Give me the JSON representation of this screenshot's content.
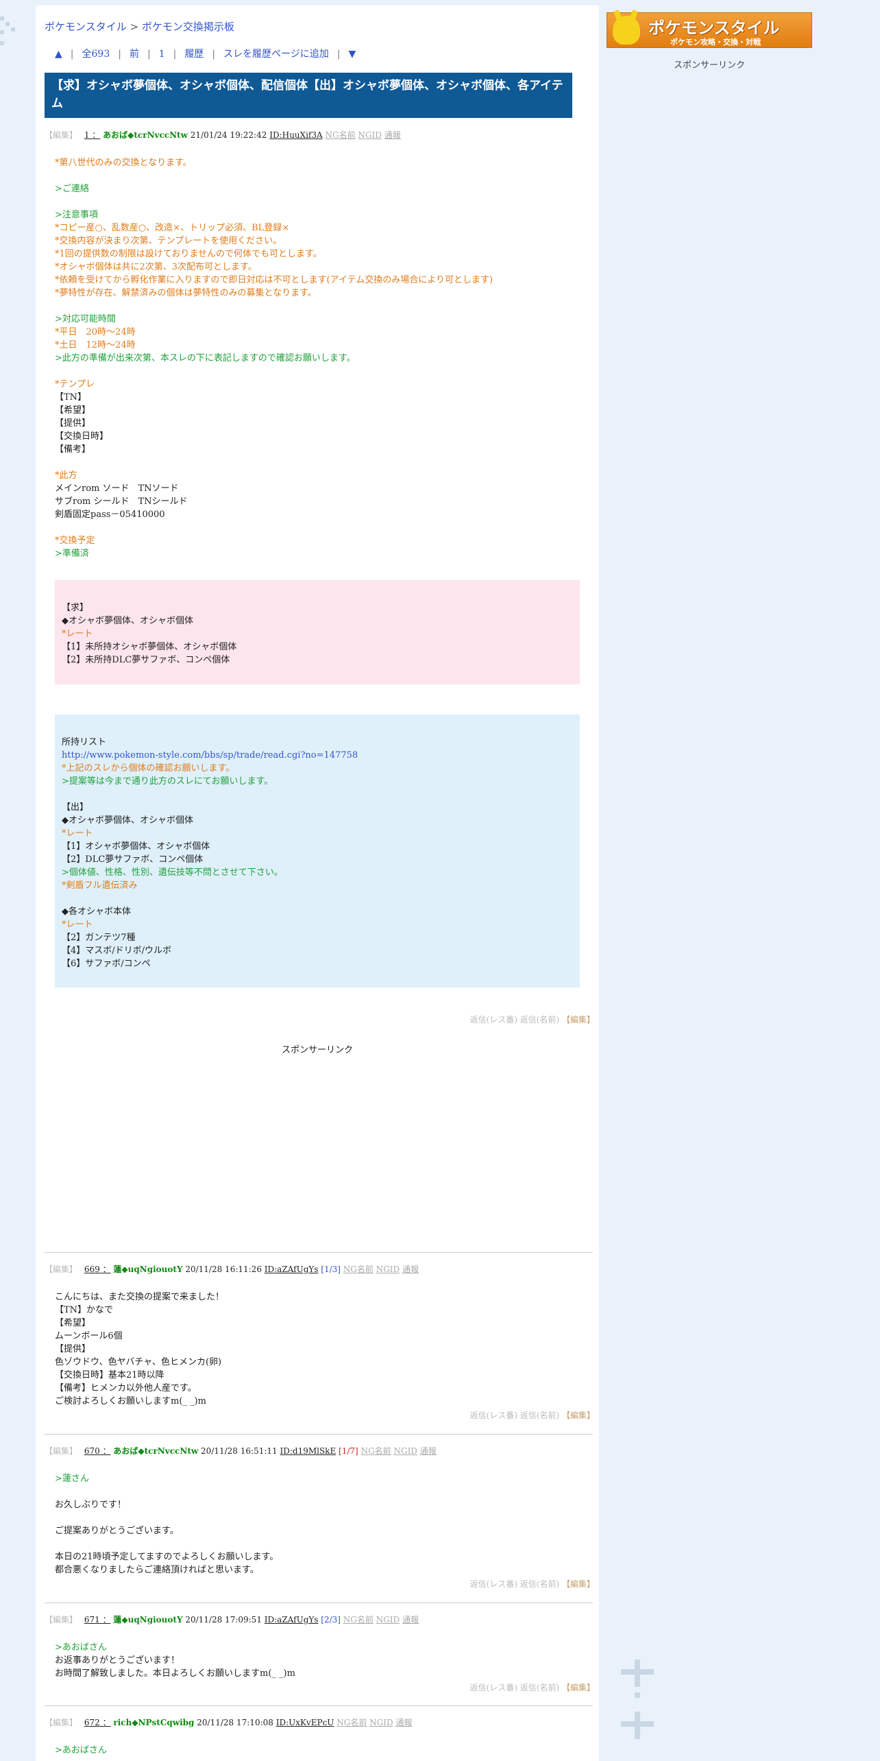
{
  "breadcrumb": {
    "home": "ポケモンスタイル",
    "sep": " > ",
    "board": "ポケモン交換掲示板"
  },
  "nav": [
    {
      "name": "nav-top",
      "label": "▲"
    },
    {
      "name": "nav-all",
      "label": "全693"
    },
    {
      "name": "nav-prev",
      "label": "前"
    },
    {
      "name": "nav-first",
      "label": "1"
    },
    {
      "name": "nav-history",
      "label": "履歴"
    },
    {
      "name": "nav-add-history",
      "label": "スレを履歴ページに追加"
    },
    {
      "name": "nav-bottom",
      "label": "▼"
    }
  ],
  "nav_sep": "|",
  "thread_title": "【求】オシャボ夢個体、オシャボ個体、配信個体【出】オシャボ夢個体、オシャボ個体、各アイテム",
  "labels": {
    "edit": "【編集】",
    "ng_name": "NG名前",
    "ngid": "NGID",
    "report": "通報",
    "reply_res": "返信(レス番)",
    "reply_name": "返信(名前)",
    "edit_foot": "【編集】"
  },
  "sponsor": "スポンサーリンク",
  "side": {
    "banner_title": "ポケモンスタイル",
    "banner_sub": "ポケモン攻略・交換・対戦",
    "sponsor": "スポンサーリンク"
  },
  "colors": {
    "title_bg": "#0f5995",
    "orange": "#e07b1a",
    "green": "#22a03a",
    "name": "#118811",
    "pink_box": "#fde5ee",
    "blue_box": "#dff0fa"
  },
  "op": {
    "num": "1 ：",
    "name": "あおば◆tcrNvccNtw",
    "date": "21/01/24 19:22:42",
    "id": "ID:HuuXif3A",
    "lines": [
      {
        "c": "or",
        "t": "*第八世代のみの交換となります。"
      },
      {
        "c": "bk",
        "t": ""
      },
      {
        "c": "gr",
        "t": ">ご連絡"
      },
      {
        "c": "bk",
        "t": ""
      },
      {
        "c": "gr",
        "t": ">注意事項"
      },
      {
        "c": "or",
        "t": "*コピー産○、乱数産○、改造×、トリップ必須、BL登録×"
      },
      {
        "c": "or",
        "t": "*交換内容が決まり次第、テンプレートを使用ください。"
      },
      {
        "c": "or",
        "t": "*1回の提供数の制限は設けておりませんので何体でも可とします。"
      },
      {
        "c": "or",
        "t": "*オシャボ個体は共に2次第、3次配布可とします。"
      },
      {
        "c": "or",
        "t": "*依頼を受けてから孵化作業に入りますので即日対応は不可とします(アイテム交換のみ場合により可とします)"
      },
      {
        "c": "or",
        "t": "*夢特性が存在、解禁済みの個体は夢特性のみの募集となります。"
      },
      {
        "c": "bk",
        "t": ""
      },
      {
        "c": "gr",
        "t": ">対応可能時間"
      },
      {
        "c": "or",
        "t": "*平日　20時～24時"
      },
      {
        "c": "or",
        "t": "*土日　12時～24時"
      },
      {
        "c": "gr",
        "t": ">此方の準備が出来次第、本スレの下に表記しますので確認お願いします。"
      },
      {
        "c": "bk",
        "t": ""
      },
      {
        "c": "or",
        "t": "*テンプレ"
      },
      {
        "c": "bk",
        "t": "【TN】"
      },
      {
        "c": "bk",
        "t": "【希望】"
      },
      {
        "c": "bk",
        "t": "【提供】"
      },
      {
        "c": "bk",
        "t": "【交換日時】"
      },
      {
        "c": "bk",
        "t": "【備考】"
      },
      {
        "c": "bk",
        "t": ""
      },
      {
        "c": "or",
        "t": "*此方"
      },
      {
        "c": "bk",
        "t": "メインrom ソード　TNソード"
      },
      {
        "c": "bk",
        "t": "サブrom シールド　TNシールド"
      },
      {
        "c": "bk",
        "t": "剣盾固定pass－05410000"
      },
      {
        "c": "bk",
        "t": ""
      },
      {
        "c": "or",
        "t": "*交換予定"
      },
      {
        "c": "gr",
        "t": ">準備済"
      }
    ],
    "pink_lines": [
      {
        "c": "bk",
        "t": ""
      },
      {
        "c": "bk",
        "t": "【求】"
      },
      {
        "c": "bk",
        "t": "◆オシャボ夢個体、オシャボ個体"
      },
      {
        "c": "or",
        "t": "*レート"
      },
      {
        "c": "bk",
        "t": "【1】未所持オシャボ夢個体、オシャボ個体"
      },
      {
        "c": "bk",
        "t": "【2】未所持DLC夢サファボ、コンペ個体"
      }
    ],
    "blue_lines": [
      {
        "c": "bk",
        "t": ""
      },
      {
        "c": "bk",
        "t": "所持リスト"
      },
      {
        "c": "ln",
        "t": "http://www.pokemon-style.com/bbs/sp/trade/read.cgi?no=147758"
      },
      {
        "c": "or",
        "t": "*上記のスレから個体の確認お願いします。"
      },
      {
        "c": "gr",
        "t": ">提案等は今まで通り此方のスレにてお願いします。"
      },
      {
        "c": "bk",
        "t": ""
      },
      {
        "c": "bk",
        "t": "【出】"
      },
      {
        "c": "bk",
        "t": "◆オシャボ夢個体、オシャボ個体"
      },
      {
        "c": "or",
        "t": "*レート"
      },
      {
        "c": "bk",
        "t": "【1】オシャボ夢個体、オシャボ個体"
      },
      {
        "c": "bk",
        "t": "【2】DLC夢サファボ、コンペ個体"
      },
      {
        "c": "gr",
        "t": ">個体値、性格、性別、遺伝技等不問とさせて下さい。"
      },
      {
        "c": "or",
        "t": "*剣盾フル遺伝済み"
      },
      {
        "c": "bk",
        "t": ""
      },
      {
        "c": "bk",
        "t": "◆各オシャボ本体"
      },
      {
        "c": "or",
        "t": "*レート"
      },
      {
        "c": "bk",
        "t": "【2】ガンテツ7種"
      },
      {
        "c": "bk",
        "t": "【4】マスボ/ドリボ/ウルボ"
      },
      {
        "c": "bk",
        "t": "【6】サファボ/コンペ"
      }
    ]
  },
  "replies": [
    {
      "num": "669 ：",
      "name": "蓮◆uqNgiouotY",
      "date": "20/11/28 16:11:26",
      "id": "ID:aZAfUgYs",
      "count": "[1/3]",
      "lines": [
        {
          "c": "bk",
          "t": "こんにちは、また交換の提案で来ました！"
        },
        {
          "c": "bk",
          "t": "【TN】かなで"
        },
        {
          "c": "bk",
          "t": "【希望】"
        },
        {
          "c": "bk",
          "t": "ムーンボール6個"
        },
        {
          "c": "bk",
          "t": "【提供】"
        },
        {
          "c": "bk",
          "t": "色ゾウドウ、色ヤバチャ、色ヒメンカ(卵)"
        },
        {
          "c": "bk",
          "t": "【交換日時】基本21時以降"
        },
        {
          "c": "bk",
          "t": "【備考】ヒメンカ以外他人産です。"
        },
        {
          "c": "bk",
          "t": "ご検討よろしくお願いしますm(_ _)m"
        }
      ]
    },
    {
      "num": "670 ：",
      "name": "あおば◆tcrNvccNtw",
      "date": "20/11/28 16:51:11",
      "id": "ID:d19MlSkE",
      "count": "[1/7]",
      "lines": [
        {
          "c": "gr",
          "t": ">蓮さん"
        },
        {
          "c": "bk",
          "t": ""
        },
        {
          "c": "bk",
          "t": "お久しぶりです！"
        },
        {
          "c": "bk",
          "t": ""
        },
        {
          "c": "bk",
          "t": "ご提案ありがとうございます。"
        },
        {
          "c": "bk",
          "t": ""
        },
        {
          "c": "bk",
          "t": "本日の21時頃予定してますのでよろしくお願いします。"
        },
        {
          "c": "bk",
          "t": "都合悪くなりましたらご連絡頂ければと思います。"
        }
      ]
    },
    {
      "num": "671 ：",
      "name": "蓮◆uqNgiouotY",
      "date": "20/11/28 17:09:51",
      "id": "ID:aZAfUgYs",
      "count": "[2/3]",
      "lines": [
        {
          "c": "gr",
          "t": ">あおばさん"
        },
        {
          "c": "bk",
          "t": "お返事ありがとうございます！"
        },
        {
          "c": "bk",
          "t": "お時間了解致しました。本日よろしくお願いしますm(_ _)m"
        }
      ]
    },
    {
      "num": "672 ：",
      "name": "rich◆NPstCqwibg",
      "date": "20/11/28 17:10:08",
      "id": "ID:UxKvEPcU",
      "count": "",
      "lines": [
        {
          "c": "gr",
          "t": ">あおばさん"
        }
      ]
    }
  ]
}
